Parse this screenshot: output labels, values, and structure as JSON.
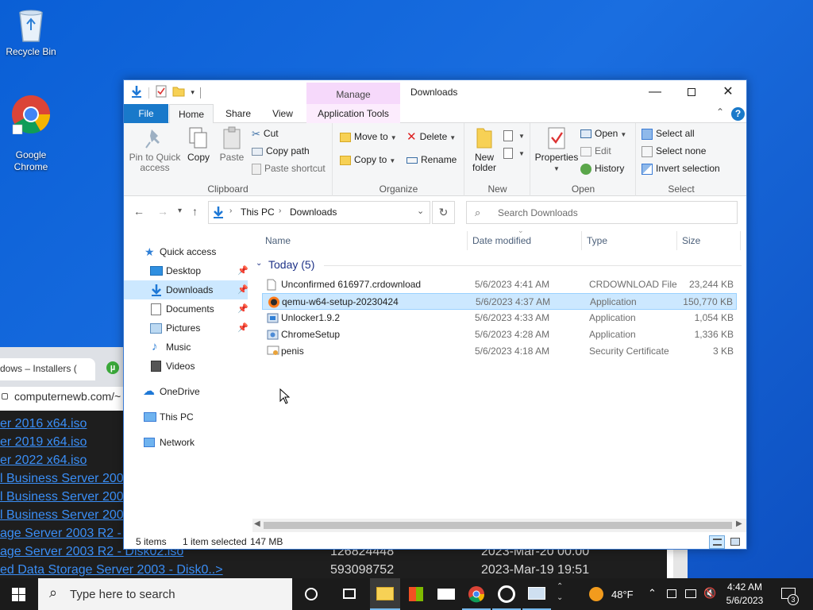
{
  "desktop": {
    "icons": [
      {
        "label": "Recycle Bin"
      },
      {
        "label": "Google\nChrome"
      }
    ]
  },
  "browser": {
    "tab_title": "dows – Installers (",
    "address": "computernewb.com/~",
    "rows": [
      {
        "name": "er 2016 x64.iso",
        "size": "",
        "date": ""
      },
      {
        "name": "er 2019 x64.iso",
        "size": "",
        "date": ""
      },
      {
        "name": "er 2022 x64.iso",
        "size": "",
        "date": ""
      },
      {
        "name": "l Business Server 200",
        "size": "",
        "date": ""
      },
      {
        "name": "l Business Server 200",
        "size": "",
        "date": ""
      },
      {
        "name": "l Business Server 200",
        "size": "",
        "date": ""
      },
      {
        "name": "age Server 2003 R2 - I",
        "size": "",
        "date": ""
      },
      {
        "name": "age Server 2003 R2 - Disk02.iso",
        "size": "126824448",
        "date": "2023-Mar-20 00:00"
      },
      {
        "name": "ed Data Storage Server 2003 - Disk0..>",
        "size": "593098752",
        "date": "2023-Mar-19 19:51"
      }
    ]
  },
  "explorer": {
    "manage_label": "Manage",
    "title": "Downloads",
    "tabs": {
      "file": "File",
      "home": "Home",
      "share": "Share",
      "view": "View",
      "app_tools": "Application Tools"
    },
    "ribbon": {
      "clipboard": {
        "label": "Clipboard",
        "pin": "Pin to Quick access",
        "copy": "Copy",
        "paste": "Paste",
        "cut": "Cut",
        "copy_path": "Copy path",
        "paste_shortcut": "Paste shortcut"
      },
      "organize": {
        "label": "Organize",
        "move_to": "Move to",
        "copy_to": "Copy to",
        "delete": "Delete",
        "rename": "Rename"
      },
      "new": {
        "label": "New",
        "new_folder": "New folder"
      },
      "open": {
        "label": "Open",
        "properties": "Properties",
        "open": "Open",
        "edit": "Edit",
        "history": "History"
      },
      "select": {
        "label": "Select",
        "select_all": "Select all",
        "select_none": "Select none",
        "invert": "Invert selection"
      }
    },
    "address": {
      "this_pc": "This PC",
      "downloads": "Downloads"
    },
    "search_placeholder": "Search Downloads",
    "nav": [
      {
        "label": "Quick access",
        "indent": 0,
        "icon": "star-icon"
      },
      {
        "label": "Desktop",
        "indent": 1,
        "icon": "desktop-icon",
        "pinned": true
      },
      {
        "label": "Downloads",
        "indent": 1,
        "icon": "download-arrow-icon",
        "pinned": true,
        "selected": true
      },
      {
        "label": "Documents",
        "indent": 1,
        "icon": "documents-icon",
        "pinned": true
      },
      {
        "label": "Pictures",
        "indent": 1,
        "icon": "pictures-icon",
        "pinned": true
      },
      {
        "label": "Music",
        "indent": 1,
        "icon": "music-icon"
      },
      {
        "label": "Videos",
        "indent": 1,
        "icon": "videos-icon"
      },
      {
        "label": "OneDrive",
        "indent": 0,
        "icon": "cloud-icon"
      },
      {
        "label": "This PC",
        "indent": 0,
        "icon": "computer-icon"
      },
      {
        "label": "Network",
        "indent": 0,
        "icon": "network-icon"
      }
    ],
    "columns": {
      "name": "Name",
      "date": "Date modified",
      "type": "Type",
      "size": "Size"
    },
    "group": "Today (5)",
    "files": [
      {
        "name": "Unconfirmed 616977.crdownload",
        "date": "5/6/2023 4:41 AM",
        "type": "CRDOWNLOAD File",
        "size": "23,244 KB",
        "icon": "blank-file-icon"
      },
      {
        "name": "qemu-w64-setup-20230424",
        "date": "5/6/2023 4:37 AM",
        "type": "Application",
        "size": "150,770 KB",
        "icon": "qemu-icon",
        "selected": true
      },
      {
        "name": "Unlocker1.9.2",
        "date": "5/6/2023 4:33 AM",
        "type": "Application",
        "size": "1,054 KB",
        "icon": "installer-icon"
      },
      {
        "name": "ChromeSetup",
        "date": "5/6/2023 4:28 AM",
        "type": "Application",
        "size": "1,336 KB",
        "icon": "installer-icon"
      },
      {
        "name": "penis",
        "date": "5/6/2023 4:18 AM",
        "type": "Security Certificate",
        "size": "3 KB",
        "icon": "certificate-icon"
      }
    ],
    "status": {
      "items": "5 items",
      "selected": "1 item selected",
      "size": "147 MB"
    }
  },
  "taskbar": {
    "search_placeholder": "Type here to search",
    "weather": "48°F",
    "time": "4:42 AM",
    "date": "5/6/2023",
    "notifications": "3"
  },
  "colors": {
    "accent": "#1979ca",
    "selection": "#cce8ff",
    "manage": "#f6d9fb"
  }
}
